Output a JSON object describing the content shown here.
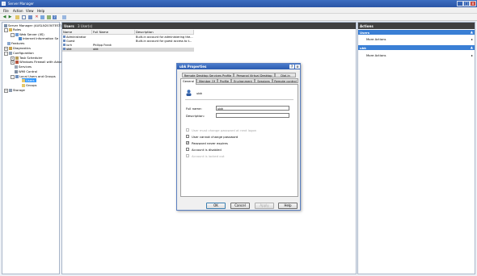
{
  "window": {
    "title": "Server Manager",
    "min": "_",
    "max": "□",
    "close": "x"
  },
  "menu": [
    "File",
    "Action",
    "View",
    "Help"
  ],
  "toolbar": [
    "back-icon",
    "forward-icon",
    "up-icon",
    "show-hide-tree-icon",
    "delete-icon",
    "properties-icon",
    "refresh-icon",
    "export-icon",
    "help-icon",
    "users-icon"
  ],
  "tree": {
    "items": [
      {
        "label": "Server Manager (AUSLN2030TEST)",
        "icon": "server-icon"
      },
      {
        "label": "Roles",
        "icon": "roles-icon"
      },
      {
        "label": "Web Server (IIS)",
        "icon": "web-server-icon"
      },
      {
        "label": "Internet Information Se",
        "icon": "iis-icon"
      },
      {
        "label": "Features",
        "icon": "features-icon"
      },
      {
        "label": "Diagnostics",
        "icon": "diagnostics-icon"
      },
      {
        "label": "Configuration",
        "icon": "configuration-icon"
      },
      {
        "label": "Task Scheduler",
        "icon": "task-scheduler-icon"
      },
      {
        "label": "Windows Firewall with Adva",
        "icon": "firewall-icon"
      },
      {
        "label": "Services",
        "icon": "services-icon"
      },
      {
        "label": "WMI Control",
        "icon": "wmi-icon"
      },
      {
        "label": "Local Users and Groups",
        "icon": "users-groups-icon"
      },
      {
        "label": "Users",
        "icon": "folder-icon"
      },
      {
        "label": "Groups",
        "icon": "folder-icon"
      },
      {
        "label": "Storage",
        "icon": "storage-icon"
      }
    ]
  },
  "center": {
    "title": "Users",
    "count": "3 User(s)",
    "columns": [
      "Name",
      "Full Name",
      "Description"
    ],
    "rows": [
      [
        "Administrator",
        "",
        "Built-in account for administering the..."
      ],
      [
        "Guest",
        "",
        "Built-in account for guest access to t..."
      ],
      [
        "iurh",
        "Philipp Frank",
        ""
      ],
      [
        "ubk",
        "ubk",
        ""
      ]
    ]
  },
  "actions": {
    "title": "Actions",
    "sections": [
      {
        "name": "Users",
        "item": "More Actions"
      },
      {
        "name": "ubk",
        "item": "More Actions"
      }
    ]
  },
  "dialog": {
    "title": "ubk Properties",
    "help": "?",
    "close": "x",
    "tabs_row1": [
      "Remote Desktop Services Profile",
      "Personal Virtual Desktop",
      "Dial-in"
    ],
    "tabs_row2": [
      "General",
      "Member Of",
      "Profile",
      "Environment",
      "Sessions",
      "Remote control"
    ],
    "username": "ubk",
    "full_name_label": "Full name:",
    "full_name_value": "ubk",
    "description_label": "Description:",
    "description_value": "",
    "checkboxes": [
      {
        "label": "User must change password at next logon",
        "checked": false,
        "disabled": true
      },
      {
        "label": "User cannot change password",
        "checked": false,
        "disabled": false
      },
      {
        "label": "Password never expires",
        "checked": true,
        "disabled": false
      },
      {
        "label": "Account is disabled",
        "checked": false,
        "disabled": false
      },
      {
        "label": "Account is locked out",
        "checked": false,
        "disabled": true
      }
    ],
    "buttons": [
      "OK",
      "Cancel",
      "Apply",
      "Help"
    ]
  }
}
